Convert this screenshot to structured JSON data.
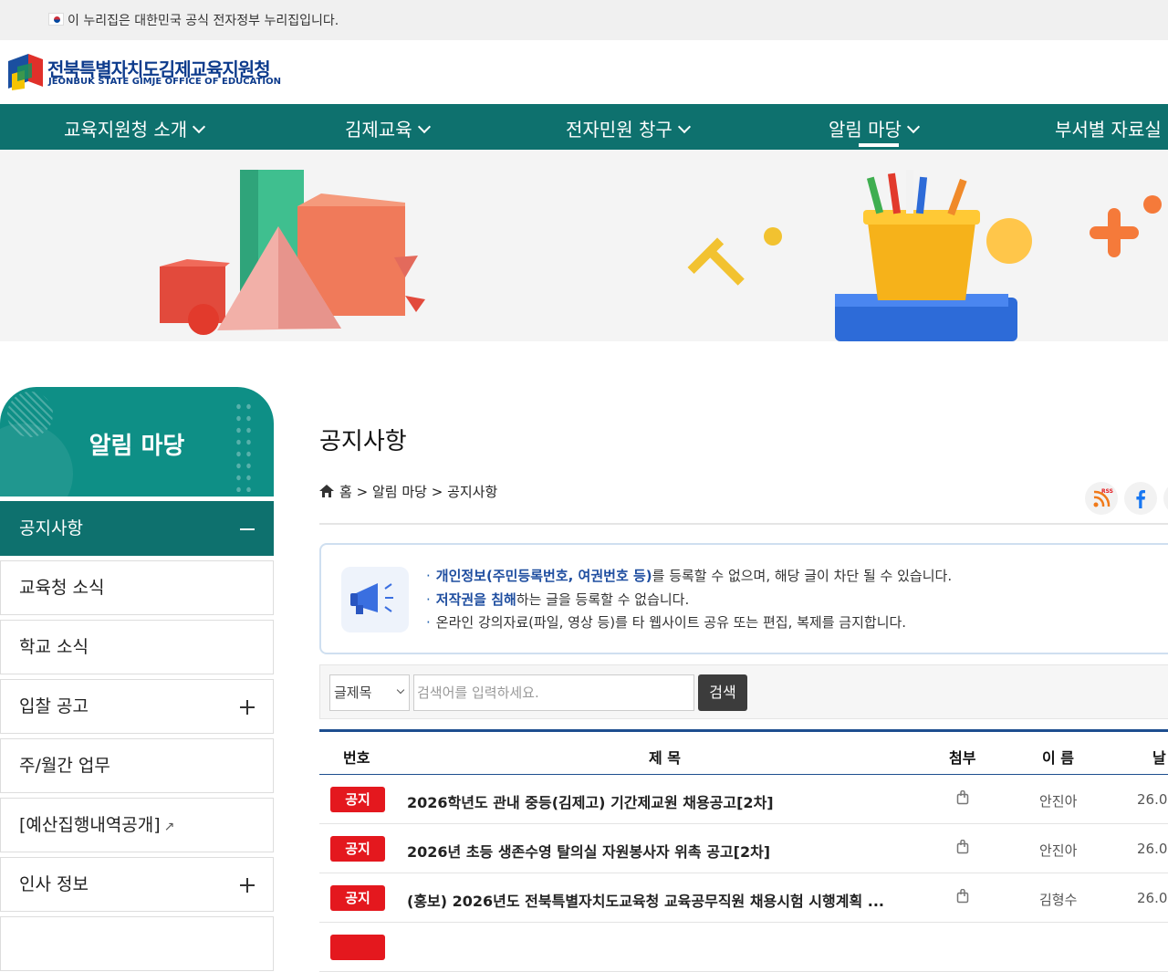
{
  "topbar": {
    "text": "이 누리집은 대한민국 공식 전자정부 누리집입니다."
  },
  "logo": {
    "korean": "전북특별자치도김제교육지원청",
    "english": "JEONBUK STATE GIMJE OFFICE OF EDUCATION"
  },
  "gnb": {
    "items": [
      {
        "label": "교육지원청 소개"
      },
      {
        "label": "김제교육"
      },
      {
        "label": "전자민원 창구"
      },
      {
        "label": "알림 마당"
      },
      {
        "label": "부서별 자료실"
      }
    ]
  },
  "lnb": {
    "title": "알림 마당",
    "items": [
      {
        "label": "공지사항"
      },
      {
        "label": "교육청 소식"
      },
      {
        "label": "학교 소식"
      },
      {
        "label": "입찰 공고"
      },
      {
        "label": "주/월간 업무"
      },
      {
        "label": "[예산집행내역공개]"
      },
      {
        "label": "인사 정보"
      }
    ]
  },
  "main": {
    "title": "공지사항",
    "breadcrumb": {
      "home": "홈",
      "sep": ">",
      "section": "알림 마당",
      "page": "공지사항"
    },
    "sns": {
      "rss_label": "RSS"
    }
  },
  "notice": {
    "line1_bold": "개인정보(주민등록번호, 여권번호 등)",
    "line1_rest": "를 등록할 수 없으며, 해당 글이 차단 될 수 있습니다.",
    "line2_bold": "저작권을 침해",
    "line2_rest": "하는 글을 등록할 수 없습니다.",
    "line3": "온라인 강의자료(파일, 영상 등)를 타 웹사이트 공유 또는 편집, 복제를 금지합니다."
  },
  "search": {
    "select_value": "글제목",
    "placeholder": "검색어를 입력하세요.",
    "button": "검색"
  },
  "table": {
    "headers": {
      "num": "번호",
      "title": "제 목",
      "attach": "첨부",
      "name": "이 름",
      "date": "날"
    },
    "rows": [
      {
        "badge": "공지",
        "title": "2026학년도 관내 중등(김제고) 기간제교원 채용공고[2차]",
        "author": "안진아",
        "date": "26.0"
      },
      {
        "badge": "공지",
        "title": "2026년 초등 생존수영 탈의실 자원봉사자 위촉 공고[2차]",
        "author": "안진아",
        "date": "26.0"
      },
      {
        "badge": "공지",
        "title": "(홍보) 2026년도 전북특별자치도교육청 교육공무직원 채용시험 시행계획 ...",
        "author": "김형수",
        "date": "26.0"
      }
    ]
  },
  "colors": {
    "primary": "#0e716e",
    "accent_blue": "#1d4e8f",
    "badge_red": "#e4181e"
  }
}
